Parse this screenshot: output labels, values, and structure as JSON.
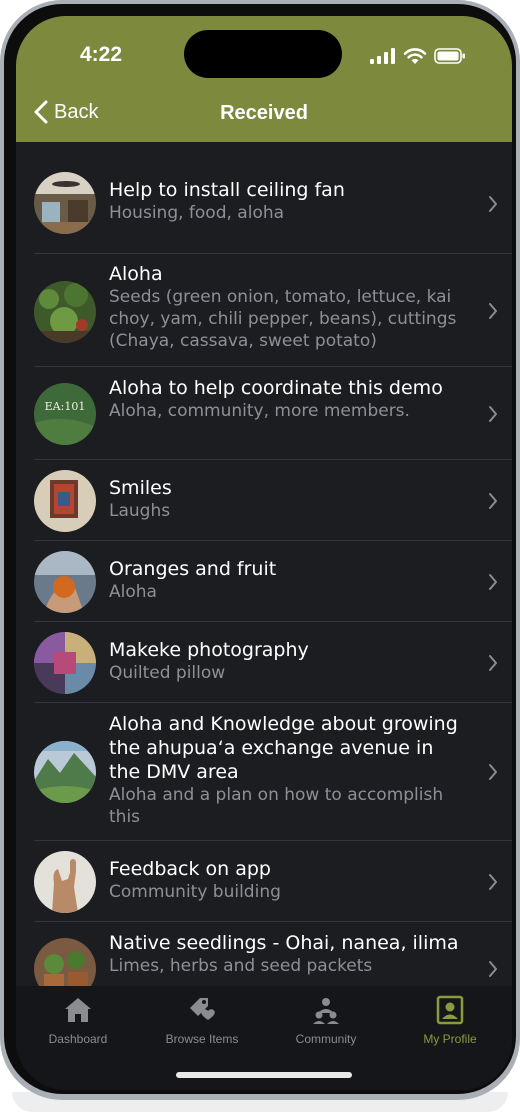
{
  "status_bar": {
    "time": "4:22"
  },
  "nav": {
    "back_label": "Back",
    "title": "Received"
  },
  "items": [
    {
      "title": "Help to install ceiling fan",
      "subtitle": "Housing, food, aloha",
      "avatar": "ceiling-room-photo"
    },
    {
      "title": "Aloha",
      "subtitle": "Seeds (green onion, tomato, lettuce, kai choy, yam, chili pepper, beans), cuttings (Chaya, cassava, sweet potato)",
      "avatar": "garden-photo"
    },
    {
      "title": "Aloha to help coordinate this demo",
      "subtitle": "Aloha, community, more members.",
      "avatar": "ea101-logo",
      "avatar_text": "EA:101"
    },
    {
      "title": "Smiles",
      "subtitle": "Laughs",
      "avatar": "framed-art-photo"
    },
    {
      "title": "Oranges and fruit",
      "subtitle": "Aloha",
      "avatar": "orange-hand-photo"
    },
    {
      "title": "Makeke photography",
      "subtitle": "Quilted pillow",
      "avatar": "quilt-photo"
    },
    {
      "title": "Aloha and Knowledge about growing the ahupuaʻa exchange avenue in the DMV area",
      "subtitle": "Aloha and a plan on how to accomplish this",
      "avatar": "mountain-landscape-photo"
    },
    {
      "title": "Feedback on app",
      "subtitle": "Community building",
      "avatar": "shaka-hand-photo"
    },
    {
      "title": "Native seedlings - Ohai, nanea, ilima",
      "subtitle": "Limes, herbs and seed packets",
      "avatar": "seedlings-photo"
    }
  ],
  "tabs": [
    {
      "label": "Dashboard",
      "icon": "home-icon",
      "active": false
    },
    {
      "label": "Browse Items",
      "icon": "browse-items-icon",
      "active": false
    },
    {
      "label": "Community",
      "icon": "community-icon",
      "active": false
    },
    {
      "label": "My Profile",
      "icon": "profile-icon",
      "active": true
    }
  ],
  "colors": {
    "header": "#7d8a3e",
    "background": "#1b1d21",
    "tab_active": "#8a9a3e",
    "tab_inactive": "#8a8c90",
    "subtitle": "#8d9096"
  }
}
